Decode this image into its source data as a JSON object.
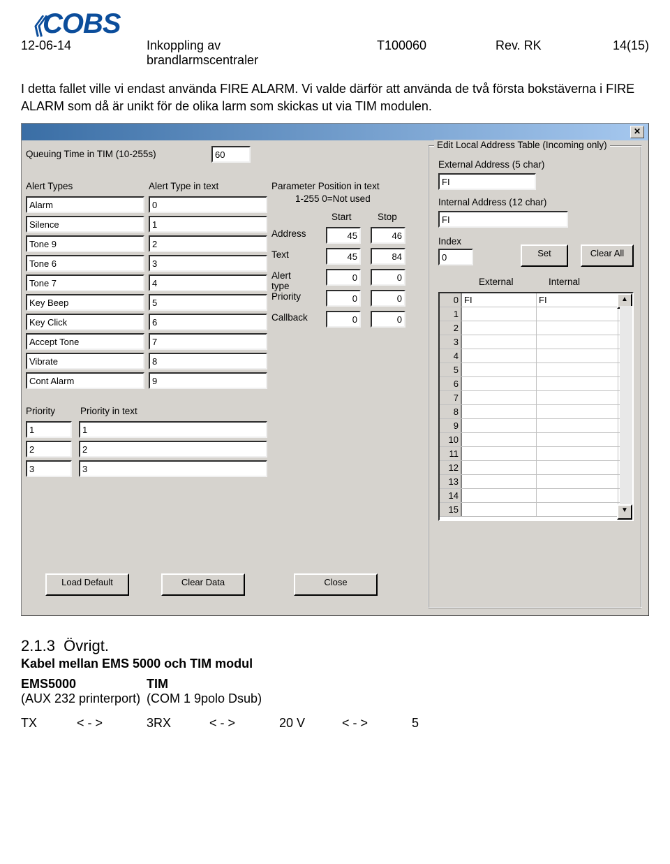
{
  "logo": "COBS",
  "header": {
    "date": "12-06-14",
    "title": "Inkoppling av brandlarmscentraler",
    "doc": "T100060",
    "rev": "Rev. RK",
    "page": "14(15)"
  },
  "para": "I detta fallet ville vi endast använda FIRE ALARM. Vi valde därför att använda de två första bokstäverna i FIRE ALARM som då är unikt för de olika larm som skickas ut via TIM modulen.",
  "dlg": {
    "queuing_label": "Queuing Time in TIM (10-255s)",
    "queuing_val": "60",
    "alert_types_hdr": "Alert Types",
    "alert_type_text_hdr": "Alert Type in text",
    "alert_rows": [
      [
        "Alarm",
        "0"
      ],
      [
        "Silence",
        "1"
      ],
      [
        "Tone 9",
        "2"
      ],
      [
        "Tone 6",
        "3"
      ],
      [
        "Tone 7",
        "4"
      ],
      [
        "Key Beep",
        "5"
      ],
      [
        "Key Click",
        "6"
      ],
      [
        "Accept Tone",
        "7"
      ],
      [
        "Vibrate",
        "8"
      ],
      [
        "Cont Alarm",
        "9"
      ]
    ],
    "param_pos_hdr": "Parameter Position in text",
    "param_pos_sub": "1-255  0=Not used",
    "start": "Start",
    "stop": "Stop",
    "param_rows": [
      [
        "Address",
        "45",
        "46"
      ],
      [
        "Text",
        "45",
        "84"
      ],
      [
        "Alert type",
        "0",
        "0"
      ],
      [
        "Priority",
        "0",
        "0"
      ],
      [
        "Callback",
        "0",
        "0"
      ]
    ],
    "prio_hdr": "Priority",
    "prio_text_hdr": "Priority in text",
    "prio_rows": [
      [
        "1",
        "1"
      ],
      [
        "2",
        "2"
      ],
      [
        "3",
        "3"
      ]
    ],
    "btn_load": "Load Default",
    "btn_clear": "Clear Data",
    "btn_close": "Close",
    "group_legend": "Edit Local Address Table (Incoming only)",
    "ext_addr_lbl": "External Address (5 char)",
    "ext_addr_val": "FI",
    "int_addr_lbl": "Internal Address (12 char)",
    "int_addr_val": "FI",
    "index_lbl": "Index",
    "index_val": "0",
    "btn_set": "Set",
    "btn_clearall": "Clear All",
    "tbl_ext": "External",
    "tbl_int": "Internal",
    "tbl_rows": [
      [
        "0",
        "FI",
        "FI"
      ],
      [
        "1",
        "",
        ""
      ],
      [
        "2",
        "",
        ""
      ],
      [
        "3",
        "",
        ""
      ],
      [
        "4",
        "",
        ""
      ],
      [
        "5",
        "",
        ""
      ],
      [
        "6",
        "",
        ""
      ],
      [
        "7",
        "",
        ""
      ],
      [
        "8",
        "",
        ""
      ],
      [
        "9",
        "",
        ""
      ],
      [
        "10",
        "",
        ""
      ],
      [
        "11",
        "",
        ""
      ],
      [
        "12",
        "",
        ""
      ],
      [
        "13",
        "",
        ""
      ],
      [
        "14",
        "",
        ""
      ],
      [
        "15",
        "",
        ""
      ]
    ]
  },
  "sec": {
    "num": "2.1.3",
    "title": "Övrigt.",
    "sub": "Kabel mellan EMS 5000 och TIM modul",
    "col1": "EMS5000",
    "col1b": "(AUX 232 printerport)",
    "col2": "TIM",
    "col2b": "(COM 1 9polo Dsub)",
    "rows": [
      [
        "TX",
        "< - >",
        "3"
      ],
      [
        "RX",
        "< - >",
        "2"
      ],
      [
        "0 V",
        "< - >",
        "5"
      ]
    ]
  }
}
